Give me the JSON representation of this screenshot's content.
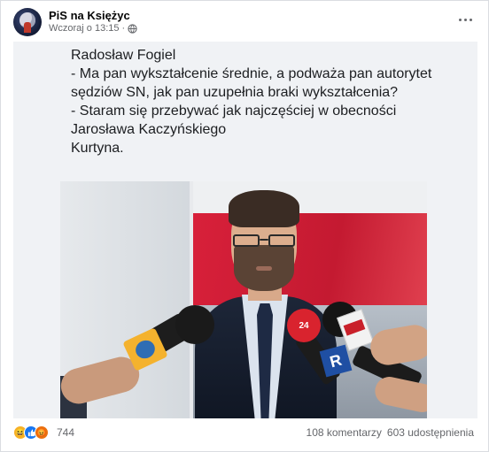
{
  "header": {
    "page_name": "PiS na Księżyc",
    "timestamp": "Wczoraj o 13:15",
    "audience_icon": "globe-icon",
    "more_icon": "more-options-icon"
  },
  "post": {
    "text": "Radosław Fogiel\n- Ma pan wykształcenie średnie, a podważa pan autorytet sędziów SN, jak pan uzupełnia braki wykształcenia?\n- Staram się przebywać jak najczęściej w obecności Jarosława Kaczyńskiego\nKurtyna."
  },
  "photo": {
    "mic_labels": {
      "red_mic": "24",
      "white_box": "TVP",
      "blue_box": "R"
    }
  },
  "footer": {
    "reactions": [
      "haha-icon",
      "like-icon",
      "angry-icon"
    ],
    "reaction_count": "744",
    "comments": "108 komentarzy",
    "shares": "603 udostępnienia"
  }
}
